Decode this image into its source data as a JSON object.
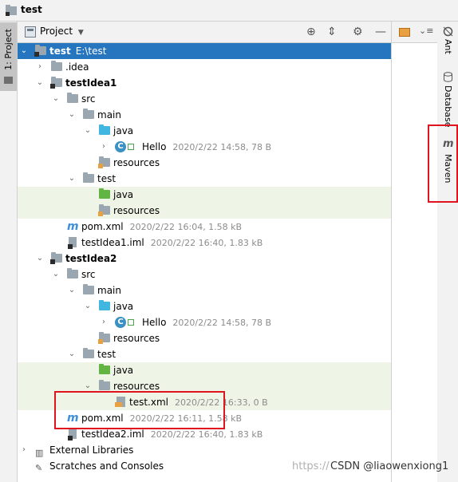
{
  "window": {
    "title": "test"
  },
  "left_toolbar": {
    "project_tab": "1: Project"
  },
  "right_toolbar": {
    "ant": "Ant",
    "database": "Database",
    "maven": "Maven"
  },
  "panel": {
    "title": "Project"
  },
  "tree": {
    "root": {
      "name": "test",
      "path": "E:\\test"
    },
    "idea": ".idea",
    "m1": {
      "name": "testIdea1",
      "src": "src",
      "main": "main",
      "java": "java",
      "hello": "Hello",
      "hello_meta": "2020/2/22 14:58, 78 B",
      "resources": "resources",
      "test": "test",
      "test_java": "java",
      "test_resources": "resources",
      "pom": "pom.xml",
      "pom_meta": "2020/2/22 16:04, 1.58 kB",
      "iml": "testIdea1.iml",
      "iml_meta": "2020/2/22 16:40, 1.83 kB"
    },
    "m2": {
      "name": "testIdea2",
      "src": "src",
      "main": "main",
      "java": "java",
      "hello": "Hello",
      "hello_meta": "2020/2/22 14:58, 78 B",
      "resources": "resources",
      "test": "test",
      "test_java": "java",
      "test_resources": "resources",
      "testxml": "test.xml",
      "testxml_meta": "2020/2/22 16:33, 0 B",
      "pom": "pom.xml",
      "pom_meta": "2020/2/22 16:11, 1.58 kB",
      "iml": "testIdea2.iml",
      "iml_meta": "2020/2/22 16:40, 1.83 kB"
    },
    "ext": "External Libraries",
    "scratches": "Scratches and Consoles"
  },
  "watermark": {
    "faint": "https://",
    "csdn": "CSDN @liaowenxiong1"
  },
  "colors": {
    "selection": "#2675bf",
    "test_highlight": "#eef5e6",
    "annotation": "#e0141e"
  }
}
